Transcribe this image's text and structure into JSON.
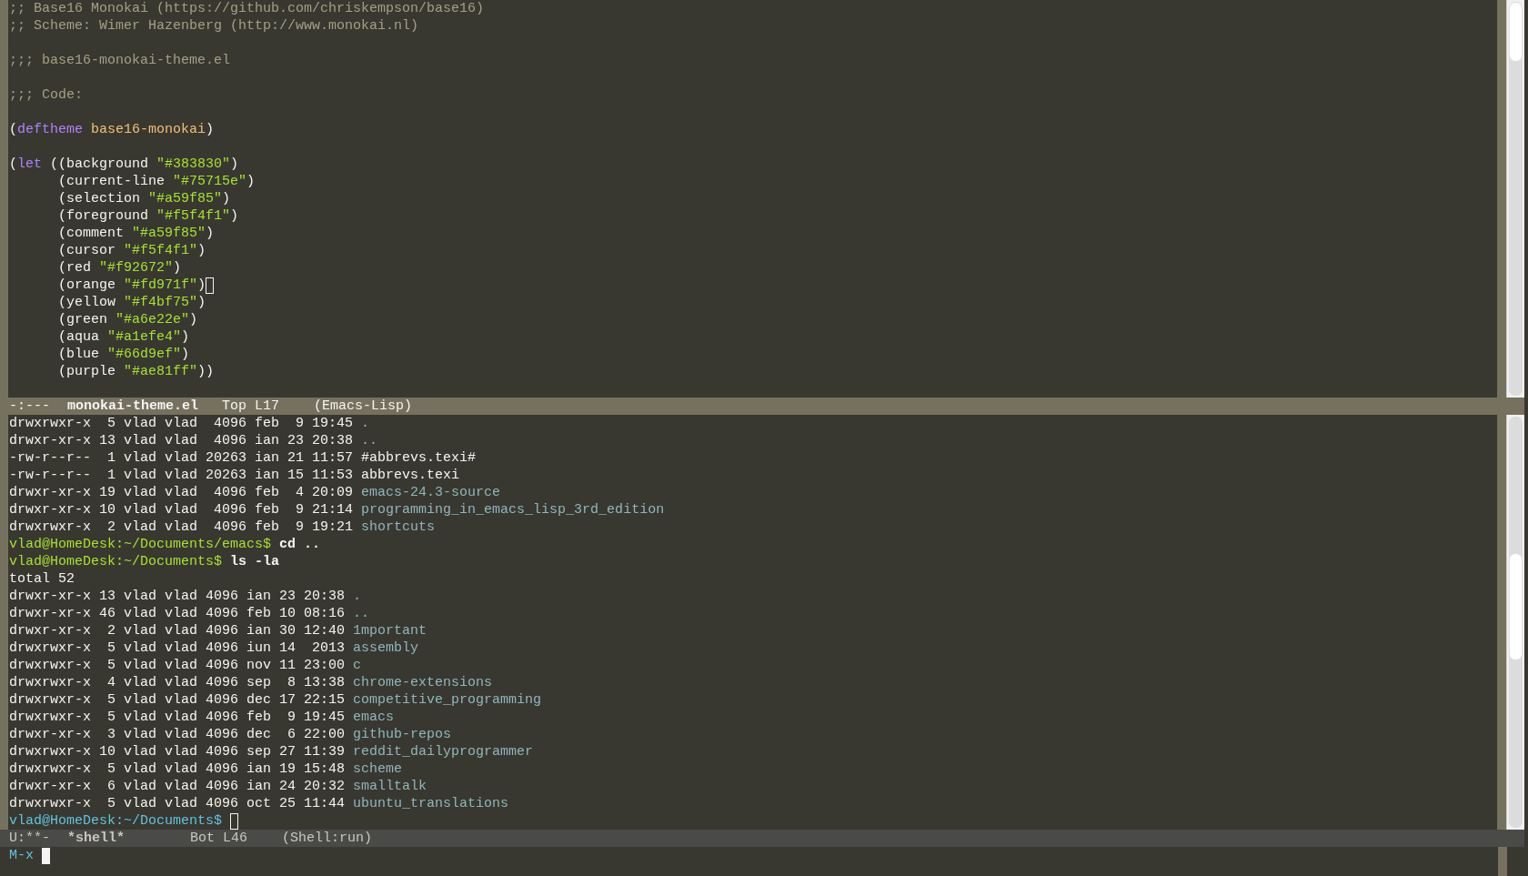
{
  "editor_window": {
    "groups": [
      [
        {
          "tokens": [
            {
              "text": ";; Base16 Monokai (https://github.com/chriskempson/base16)",
              "kind": "comment"
            }
          ]
        },
        {
          "tokens": [
            {
              "text": ";; Scheme: Wimer Hazenberg (http://www.monokai.nl)",
              "kind": "comment"
            }
          ]
        }
      ],
      [
        {
          "tokens": [
            {
              "text": ";;; base16-monokai-theme.el",
              "kind": "comment"
            }
          ]
        }
      ],
      [
        {
          "tokens": [
            {
              "text": ";;; Code:",
              "kind": "comment"
            }
          ]
        }
      ],
      [
        {
          "tokens": [
            {
              "text": "(",
              "kind": "plain"
            },
            {
              "text": "deftheme",
              "kind": "keyword"
            },
            {
              "text": " base16-monokai",
              "kind": "name"
            },
            {
              "text": ")",
              "kind": "plain"
            }
          ]
        }
      ],
      [
        {
          "tokens": [
            {
              "text": "(",
              "kind": "plain"
            },
            {
              "text": "let",
              "kind": "keyword"
            },
            {
              "text": " ((background ",
              "kind": "plain"
            },
            {
              "text": "\"#383830\"",
              "kind": "string"
            },
            {
              "text": ")",
              "kind": "plain"
            }
          ]
        },
        {
          "tokens": [
            {
              "text": "      (current-line ",
              "kind": "plain"
            },
            {
              "text": "\"#75715e\"",
              "kind": "string"
            },
            {
              "text": ")",
              "kind": "plain"
            }
          ]
        },
        {
          "tokens": [
            {
              "text": "      (selection ",
              "kind": "plain"
            },
            {
              "text": "\"#a59f85\"",
              "kind": "string"
            },
            {
              "text": ")",
              "kind": "plain"
            }
          ]
        },
        {
          "tokens": [
            {
              "text": "      (foreground ",
              "kind": "plain"
            },
            {
              "text": "\"#f5f4f1\"",
              "kind": "string"
            },
            {
              "text": ")",
              "kind": "plain"
            }
          ]
        },
        {
          "tokens": [
            {
              "text": "      (comment ",
              "kind": "plain"
            },
            {
              "text": "\"#a59f85\"",
              "kind": "string"
            },
            {
              "text": ")",
              "kind": "plain"
            }
          ]
        },
        {
          "tokens": [
            {
              "text": "      (cursor ",
              "kind": "plain"
            },
            {
              "text": "\"#f5f4f1\"",
              "kind": "string"
            },
            {
              "text": ")",
              "kind": "plain"
            }
          ]
        },
        {
          "tokens": [
            {
              "text": "      (red ",
              "kind": "plain"
            },
            {
              "text": "\"#f92672\"",
              "kind": "string"
            },
            {
              "text": ")",
              "kind": "plain"
            }
          ]
        },
        {
          "tokens": [
            {
              "text": "      (orange ",
              "kind": "plain"
            },
            {
              "text": "\"#fd971f\"",
              "kind": "string"
            },
            {
              "text": ")",
              "kind": "plain"
            },
            {
              "kind": "cursor",
              "filled": false
            }
          ]
        },
        {
          "tokens": [
            {
              "text": "      (yellow ",
              "kind": "plain"
            },
            {
              "text": "\"#f4bf75\"",
              "kind": "string"
            },
            {
              "text": ")",
              "kind": "plain"
            }
          ]
        },
        {
          "tokens": [
            {
              "text": "      (green ",
              "kind": "plain"
            },
            {
              "text": "\"#a6e22e\"",
              "kind": "string"
            },
            {
              "text": ")",
              "kind": "plain"
            }
          ]
        },
        {
          "tokens": [
            {
              "text": "      (aqua ",
              "kind": "plain"
            },
            {
              "text": "\"#a1efe4\"",
              "kind": "string"
            },
            {
              "text": ")",
              "kind": "plain"
            }
          ]
        },
        {
          "tokens": [
            {
              "text": "      (blue ",
              "kind": "plain"
            },
            {
              "text": "\"#66d9ef\"",
              "kind": "string"
            },
            {
              "text": ")",
              "kind": "plain"
            }
          ]
        },
        {
          "tokens": [
            {
              "text": "      (purple ",
              "kind": "plain"
            },
            {
              "text": "\"#ae81ff\"",
              "kind": "string"
            },
            {
              "text": "))",
              "kind": "plain"
            }
          ]
        }
      ]
    ],
    "mode_line": {
      "status": "-:---",
      "buffer": "monokai-theme.el",
      "position": "Top L17",
      "mode": "(Emacs-Lisp)",
      "active": true
    }
  },
  "shell_window": {
    "lines": [
      {
        "tokens": [
          {
            "text": "drwxrwxr-x  5 vlad vlad  4096 feb  9 19:45 ",
            "kind": "plain"
          },
          {
            "text": ".",
            "kind": "dir"
          }
        ]
      },
      {
        "tokens": [
          {
            "text": "drwxr-xr-x 13 vlad vlad  4096 ian 23 20:38 ",
            "kind": "plain"
          },
          {
            "text": "..",
            "kind": "dir"
          }
        ]
      },
      {
        "tokens": [
          {
            "text": "-rw-r--r--  1 vlad vlad 20263 ian 21 11:57 #abbrevs.texi#",
            "kind": "plain"
          }
        ]
      },
      {
        "tokens": [
          {
            "text": "-rw-r--r--  1 vlad vlad 20263 ian 15 11:53 abbrevs.texi",
            "kind": "plain"
          }
        ]
      },
      {
        "tokens": [
          {
            "text": "drwxr-xr-x 19 vlad vlad  4096 feb  4 20:09 ",
            "kind": "plain"
          },
          {
            "text": "emacs-24.3-source",
            "kind": "dir"
          }
        ]
      },
      {
        "tokens": [
          {
            "text": "drwxr-xr-x 10 vlad vlad  4096 feb  9 21:14 ",
            "kind": "plain"
          },
          {
            "text": "programming_in_emacs_lisp_3rd_edition",
            "kind": "dir"
          }
        ]
      },
      {
        "tokens": [
          {
            "text": "drwxrwxr-x  2 vlad vlad  4096 feb  9 19:21 ",
            "kind": "plain"
          },
          {
            "text": "shortcuts",
            "kind": "dir"
          }
        ]
      },
      {
        "tokens": [
          {
            "text": "vlad@HomeDesk:~/Documents/emacs$",
            "kind": "prompt"
          },
          {
            "text": " cd ..",
            "kind": "command"
          }
        ]
      },
      {
        "tokens": [
          {
            "text": "vlad@HomeDesk:~/Documents$",
            "kind": "prompt"
          },
          {
            "text": " ls -la",
            "kind": "command"
          }
        ]
      },
      {
        "tokens": [
          {
            "text": "total 52",
            "kind": "plain"
          }
        ]
      },
      {
        "tokens": [
          {
            "text": "drwxr-xr-x 13 vlad vlad 4096 ian 23 20:38 ",
            "kind": "plain"
          },
          {
            "text": ".",
            "kind": "dir"
          }
        ]
      },
      {
        "tokens": [
          {
            "text": "drwxr-xr-x 46 vlad vlad 4096 feb 10 08:16 ",
            "kind": "plain"
          },
          {
            "text": "..",
            "kind": "dir"
          }
        ]
      },
      {
        "tokens": [
          {
            "text": "drwxr-xr-x  2 vlad vlad 4096 ian 30 12:40 ",
            "kind": "plain"
          },
          {
            "text": "1mportant",
            "kind": "dir"
          }
        ]
      },
      {
        "tokens": [
          {
            "text": "drwxrwxr-x  5 vlad vlad 4096 iun 14  2013 ",
            "kind": "plain"
          },
          {
            "text": "assembly",
            "kind": "dir"
          }
        ]
      },
      {
        "tokens": [
          {
            "text": "drwxrwxr-x  5 vlad vlad 4096 nov 11 23:00 ",
            "kind": "plain"
          },
          {
            "text": "c",
            "kind": "dir"
          }
        ]
      },
      {
        "tokens": [
          {
            "text": "drwxrwxr-x  4 vlad vlad 4096 sep  8 13:38 ",
            "kind": "plain"
          },
          {
            "text": "chrome-extensions",
            "kind": "dir"
          }
        ]
      },
      {
        "tokens": [
          {
            "text": "drwxrwxr-x  5 vlad vlad 4096 dec 17 22:15 ",
            "kind": "plain"
          },
          {
            "text": "competitive_programming",
            "kind": "dir"
          }
        ]
      },
      {
        "tokens": [
          {
            "text": "drwxrwxr-x  5 vlad vlad 4096 feb  9 19:45 ",
            "kind": "plain"
          },
          {
            "text": "emacs",
            "kind": "dir"
          }
        ]
      },
      {
        "tokens": [
          {
            "text": "drwxr-xr-x  3 vlad vlad 4096 dec  6 22:00 ",
            "kind": "plain"
          },
          {
            "text": "github-repos",
            "kind": "dir"
          }
        ]
      },
      {
        "tokens": [
          {
            "text": "drwxrwxr-x 10 vlad vlad 4096 sep 27 11:39 ",
            "kind": "plain"
          },
          {
            "text": "reddit_dailyprogrammer",
            "kind": "dir"
          }
        ]
      },
      {
        "tokens": [
          {
            "text": "drwxrwxr-x  5 vlad vlad 4096 ian 19 15:48 ",
            "kind": "plain"
          },
          {
            "text": "scheme",
            "kind": "dir"
          }
        ]
      },
      {
        "tokens": [
          {
            "text": "drwxr-xr-x  6 vlad vlad 4096 ian 24 20:32 ",
            "kind": "plain"
          },
          {
            "text": "smalltalk",
            "kind": "dir"
          }
        ]
      },
      {
        "tokens": [
          {
            "text": "drwxrwxr-x  5 vlad vlad 4096 oct 25 11:44 ",
            "kind": "plain"
          },
          {
            "text": "ubuntu_translations",
            "kind": "dir"
          }
        ]
      },
      {
        "tokens": [
          {
            "text": "vlad@HomeDesk:~/Documents$ ",
            "kind": "prompt-current"
          },
          {
            "kind": "cursor",
            "filled": false
          }
        ]
      }
    ],
    "mode_line": {
      "status": "U:**-",
      "buffer": "*shell*",
      "position": "Bot L46",
      "mode": "(Shell:run)",
      "active": false
    }
  },
  "minibuffer": {
    "tokens": [
      {
        "text": "M-x ",
        "kind": "prompt-current"
      },
      {
        "kind": "cursor",
        "filled": true
      }
    ]
  }
}
